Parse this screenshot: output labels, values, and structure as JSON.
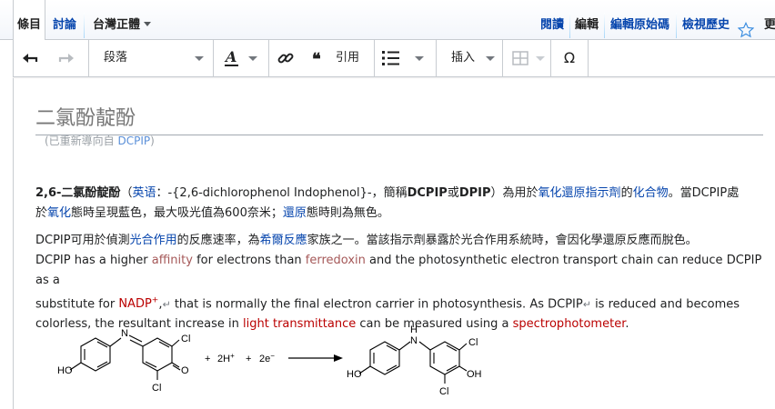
{
  "tabs": {
    "article": "條目",
    "talk": "討論",
    "variant": "台灣正體",
    "read": "閱讀",
    "edit": "編輯",
    "edit_source": "編輯原始碼",
    "history": "檢視歷史",
    "more": "更"
  },
  "toolbar": {
    "paragraph": "段落",
    "cite": "引用",
    "insert": "插入",
    "special_char": "Ω"
  },
  "page": {
    "title": "二氯酚靛酚",
    "redirect_prefix": "(已重新導向自 ",
    "redirect_link": "DCPIP",
    "redirect_suffix": ")"
  },
  "p1": {
    "bold_name": "2,6-二氯酚靛酚",
    "open_paren": "（",
    "english_link": "英语",
    "english_text": "：-{2,6-dichlorophenol Indophenol}-，簡稱",
    "abbr1": "DCPIP",
    "or": "或",
    "abbr2": "DPIP",
    "close_paren": "）為用於",
    "redox_link": "氧化還原指示劑",
    "of": "的",
    "compound_link": "化合物",
    "tail1": "。當DCPIP處",
    "line2_pre": "於",
    "oxidized_link": "氧化",
    "line2_mid": "態時呈現藍色，最大吸光值為600奈米；",
    "reduced_link": "還原",
    "line2_tail": "態時則為無色。"
  },
  "p2": {
    "pre": "DCPIP可用於偵測",
    "photosynthesis_link": "光合作用",
    "mid": "的反應速率，為",
    "hill_link": "希爾反應",
    "tail": "家族之一。當該指示劑暴露於光合作用系統時，會因化學還原反應而脫色。"
  },
  "p3": {
    "t1": "DCPIP has a higher ",
    "affinity_link": "affinity",
    "t2": " for electrons than ",
    "ferredoxin_link": "ferredoxin",
    "t3": " and the photosynthetic electron transport chain can reduce DCPIP as a",
    "t4": "substitute for ",
    "nadp_link": "NADP",
    "nadp_sup": "+",
    "t5": ",",
    "t6": " that is normally the final electron carrier in photosynthesis. As DCPIP",
    "t7": " is reduced and becomes",
    "t8": "colorless, the resultant increase in ",
    "light_link": "light transmittance",
    "t9": " can be measured using a ",
    "spectro_link": "spectrophotometer",
    "t10": "."
  },
  "reaction": {
    "cl": "Cl",
    "ho": "HO",
    "o": "O",
    "n": "N",
    "h": "H",
    "oh": "OH",
    "plus1": "+",
    "h_plus": "2H",
    "h_sup": "+",
    "plus2": "+",
    "e_minus": "2e",
    "e_sup": "−"
  }
}
